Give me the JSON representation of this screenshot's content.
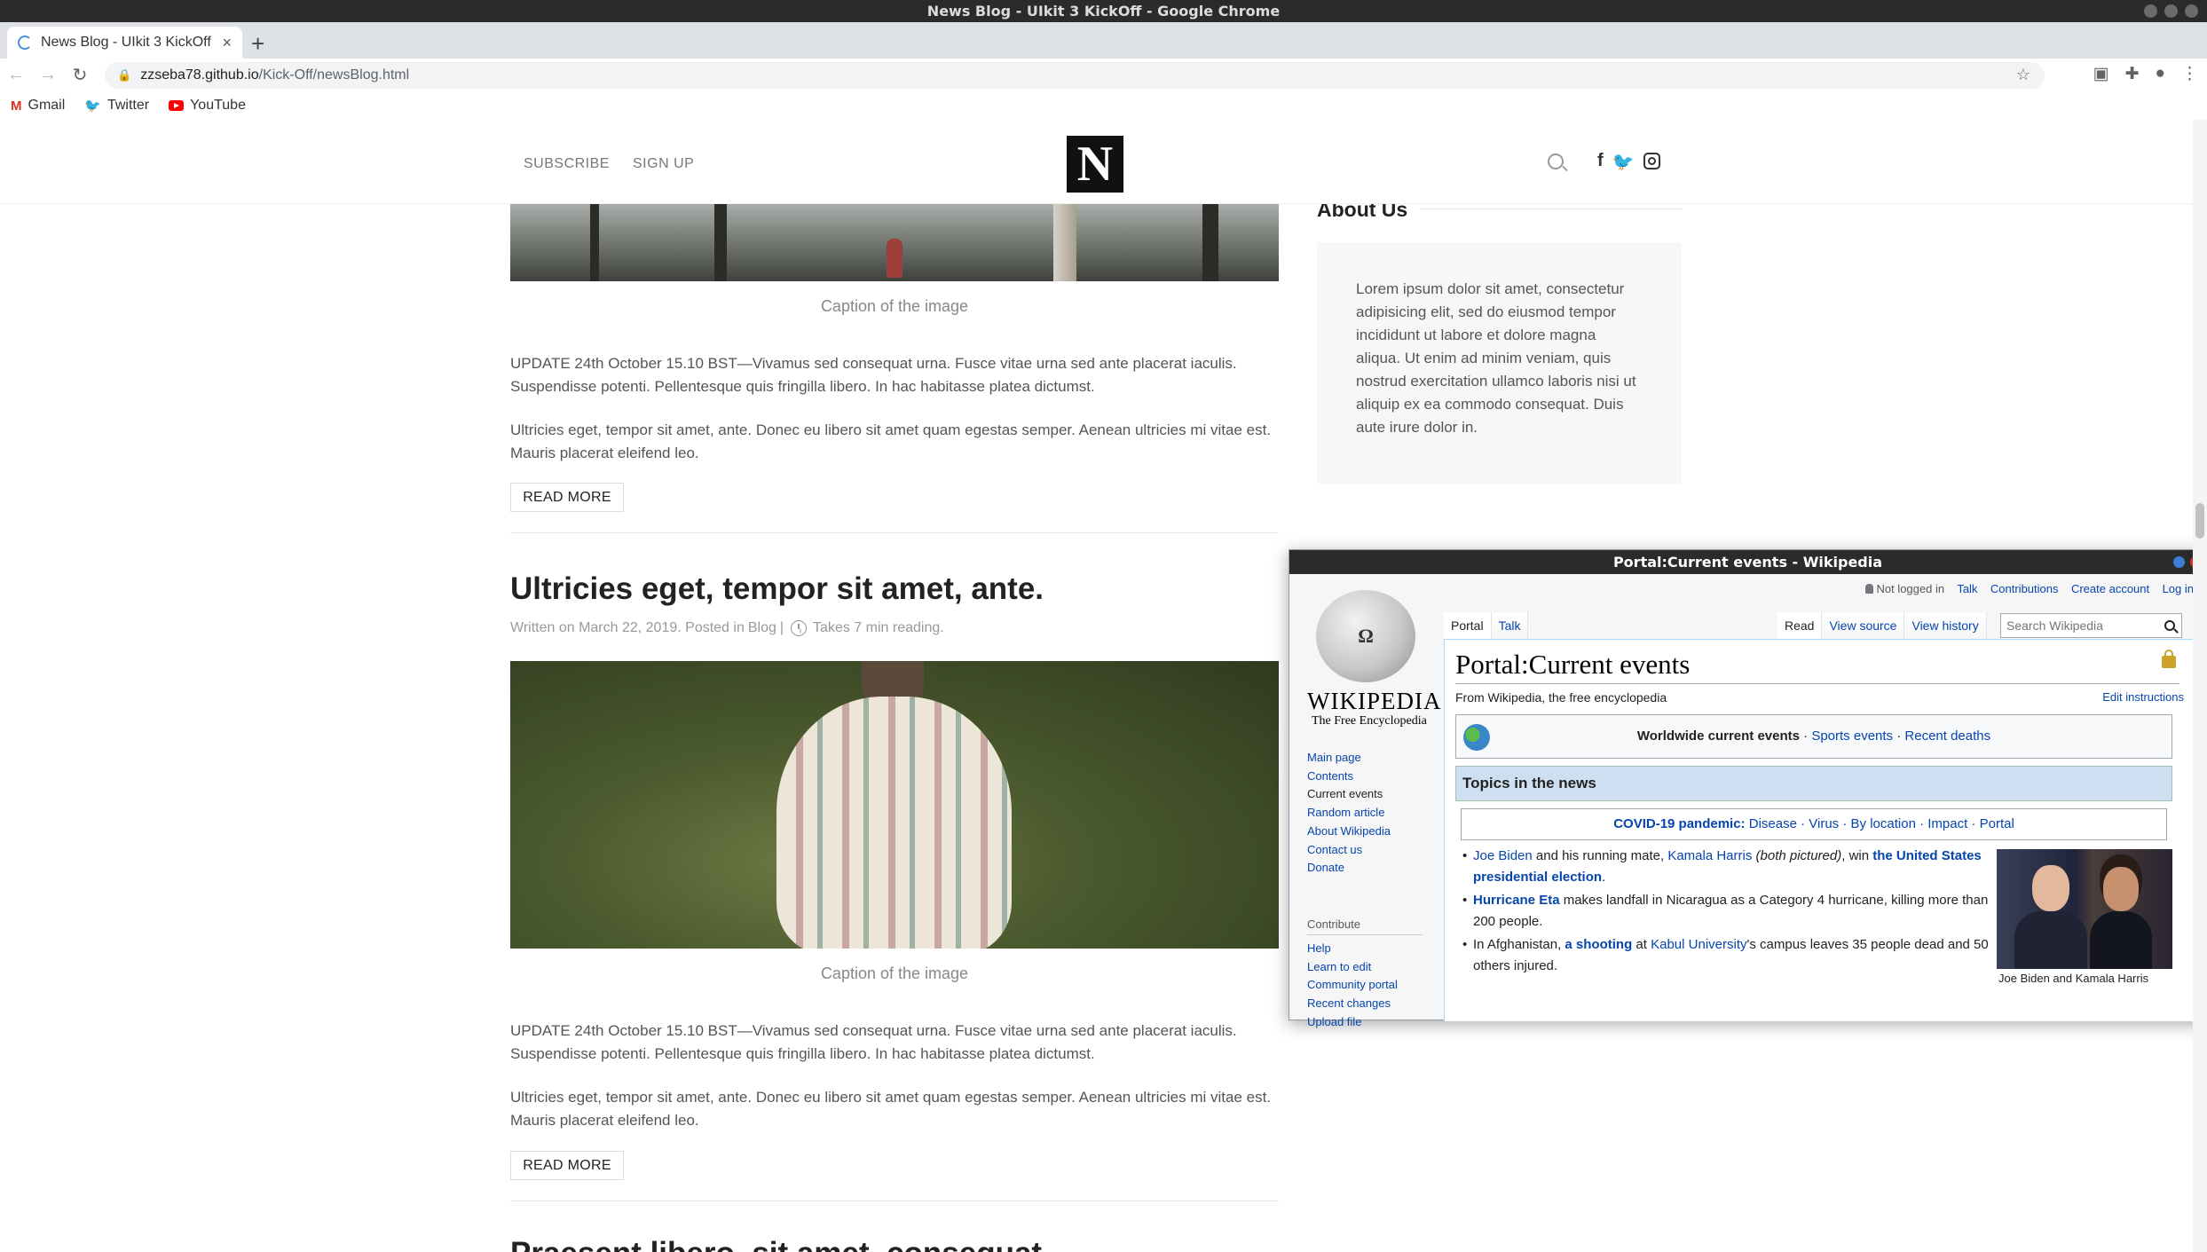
{
  "os": {
    "window_title": "News Blog - UIkit 3 KickOff - Google Chrome"
  },
  "browser": {
    "tab_title": "News Blog - UIkit 3 KickOff",
    "tab_close": "×",
    "new_tab": "+",
    "url_host": "zzseba78.github.io",
    "url_path": "/Kick-Off/newsBlog.html",
    "bookmarks": [
      {
        "label": "Gmail",
        "icon": "gmail-icon"
      },
      {
        "label": "Twitter",
        "icon": "twitter-icon"
      },
      {
        "label": "YouTube",
        "icon": "youtube-icon"
      }
    ]
  },
  "site": {
    "nav": {
      "subscribe": "SUBSCRIBE",
      "signup": "SIGN UP"
    },
    "logo": "N",
    "social": {
      "facebook": "f"
    }
  },
  "article1": {
    "caption": "Caption of the image",
    "para1": "UPDATE 24th October 15.10 BST—Vivamus sed consequat urna. Fusce vitae urna sed ante placerat iaculis. Suspendisse potenti. Pellentesque quis fringilla libero. In hac habitasse platea dictumst.",
    "para2": "Ultricies eget, tempor sit amet, ante. Donec eu libero sit amet quam egestas semper. Aenean ultricies mi vitae est. Mauris placerat eleifend leo.",
    "read_more": "READ MORE"
  },
  "article2": {
    "title": "Ultricies eget, tempor sit amet, ante.",
    "meta_prefix": "Written on March 22, 2019. Posted in",
    "meta_category": "Blog",
    "meta_sep": "|",
    "meta_reading": "Takes 7 min reading.",
    "caption": "Caption of the image",
    "para1": "UPDATE 24th October 15.10 BST—Vivamus sed consequat urna. Fusce vitae urna sed ante placerat iaculis. Suspendisse potenti. Pellentesque quis fringilla libero. In hac habitasse platea dictumst.",
    "para2": "Ultricies eget, tempor sit amet, ante. Donec eu libero sit amet quam egestas semper. Aenean ultricies mi vitae est. Mauris placerat eleifend leo.",
    "read_more": "READ MORE"
  },
  "article3": {
    "title_partial": "Praesent libero, sit amet, consequat"
  },
  "sidebar": {
    "about_title": "About Us",
    "about_text": "Lorem ipsum dolor sit amet, consectetur adipisicing elit, sed do eiusmod tempor incididunt ut labore et dolore magna aliqua. Ut enim ad minim veniam, quis nostrud exercitation ullamco laboris nisi ut aliquip ex ea commodo consequat. Duis aute irure dolor in."
  },
  "wiki": {
    "window_title": "Portal:Current events - Wikipedia",
    "wordmark": "Wikipedia",
    "tagline": "The Free Encyclopedia",
    "personal": {
      "not_logged": "Not logged in",
      "talk": "Talk",
      "contributions": "Contributions",
      "create": "Create account",
      "login": "Log in"
    },
    "tabs": {
      "portal": "Portal",
      "talk": "Talk",
      "read": "Read",
      "view_source": "View source",
      "view_history": "View history"
    },
    "search_placeholder": "Search Wikipedia",
    "nav": [
      "Main page",
      "Contents",
      "Current events",
      "Random article",
      "About Wikipedia",
      "Contact us",
      "Donate"
    ],
    "contribute_heading": "Contribute",
    "contribute": [
      "Help",
      "Learn to edit",
      "Community portal",
      "Recent changes",
      "Upload file"
    ],
    "heading": "Portal:Current events",
    "from": "From Wikipedia, the free encyclopedia",
    "edit_instructions": "Edit instructions",
    "wc": {
      "main": "Worldwide current events",
      "dot": " · ",
      "sports": "Sports events",
      "deaths": "Recent deaths"
    },
    "topics_heading": "Topics in the news",
    "covid": {
      "label": "COVID-19 pandemic:",
      "disease": "Disease",
      "virus": "Virus",
      "location": "By location",
      "impact": "Impact",
      "portal": "Portal"
    },
    "news": {
      "n1_link1": "Joe Biden",
      "n1_t1": " and his running mate, ",
      "n1_link2": "Kamala Harris",
      "n1_t2": " (both pictured)",
      "n1_t3": ", win ",
      "n1_link3": "the United States presidential election",
      "n1_t4": ".",
      "n2_link1": "Hurricane Eta",
      "n2_t1": " makes landfall in Nicaragua as a Category 4 hurricane, killing more than 200 people.",
      "n3_t1": "In Afghanistan, ",
      "n3_link1": "a shooting",
      "n3_t2": " at ",
      "n3_link2": "Kabul University",
      "n3_t3": "'s campus leaves 35 people dead and 50 others injured."
    },
    "photo_caption": "Joe Biden and Kamala Harris"
  },
  "colors": {
    "link": "#0645ad",
    "topics_bg": "#cedff2",
    "logo_bg": "#111111"
  }
}
